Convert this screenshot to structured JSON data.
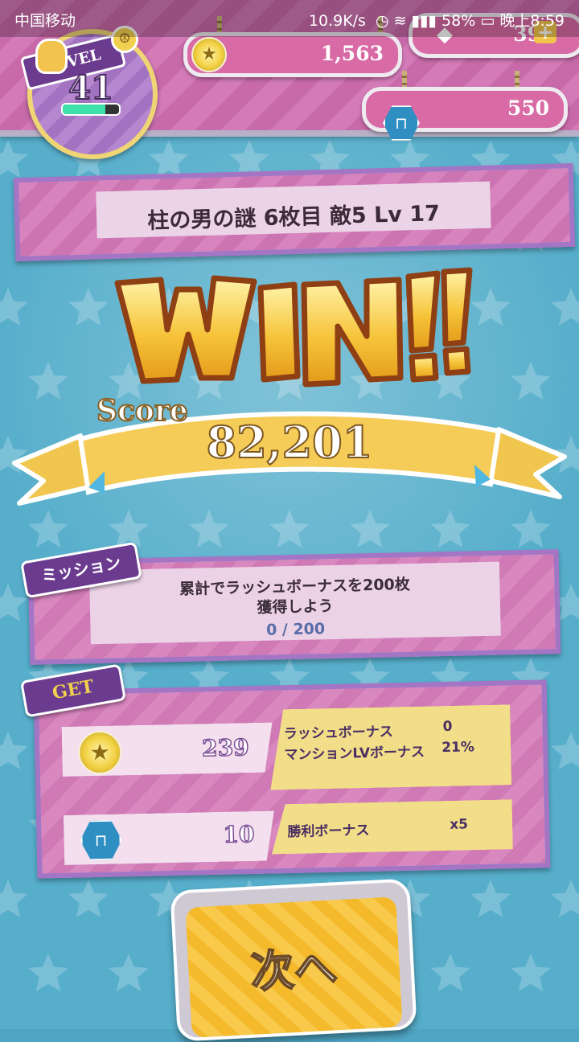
{
  "status_bar": {
    "carrier": "中国移动",
    "net_speed": "10.9K/s",
    "battery": "58%",
    "time": "晚上8:59"
  },
  "header": {
    "level_label": "LEVEL",
    "level": "41",
    "xp_fraction": 0.75,
    "coins": "1,563",
    "gems": "39",
    "chairs": "550"
  },
  "stage": {
    "title": "柱の男の謎 6枚目 敵5 Lv 17"
  },
  "result": {
    "win_text": "WIN!!",
    "score_label": "Score",
    "score": "82,201"
  },
  "mission": {
    "tag": "ミッション",
    "line1": "累計でラッシュボーナスを200枚",
    "line2": "獲得しよう",
    "progress": "0 / 200"
  },
  "get": {
    "tag": "GET",
    "coins_earned": "239",
    "chairs_earned": "10",
    "rush_bonus_label": "ラッシュボーナス",
    "rush_bonus_value": "0",
    "mansion_bonus_label": "マンションLVボーナス",
    "mansion_bonus_value": "21%",
    "win_bonus_label": "勝利ボーナス",
    "win_bonus_value": "x5"
  },
  "next_button": {
    "label": "次へ"
  },
  "colors": {
    "background": "#56aecb",
    "panel_pink": "#d887bf",
    "panel_border": "#a475c5",
    "gold": "#f6c43a"
  }
}
